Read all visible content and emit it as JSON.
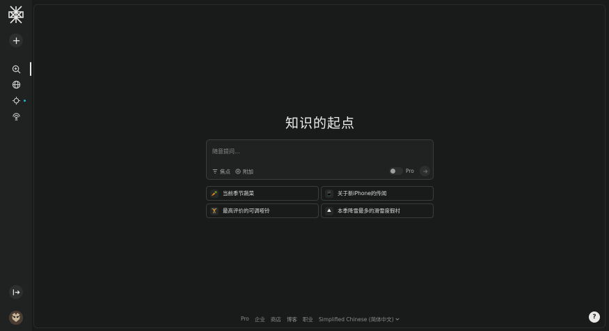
{
  "main": {
    "title": "知识的起点",
    "search": {
      "placeholder": "随意提问...",
      "focus_label": "焦点",
      "attach_label": "附加",
      "pro_label": "Pro"
    },
    "suggestions": [
      {
        "icon": "carrot-icon",
        "emoji": "🥕",
        "label": "当前季节蔬菜"
      },
      {
        "icon": "phone-icon",
        "emoji": "📱",
        "label": "关于新iPhone的传闻"
      },
      {
        "icon": "dumbbell-icon",
        "emoji": "🏋",
        "label": "最高评价的可调哑铃"
      },
      {
        "icon": "mountain-icon",
        "emoji": "⛰",
        "label": "本季降雪最多的滑雪度假村"
      }
    ],
    "footer": {
      "links": [
        "Pro",
        "企业",
        "商店",
        "博客",
        "职业"
      ],
      "language": "Simplified Chinese (简体中文)"
    },
    "help_label": "?"
  },
  "colors": {
    "background": "#191a1a",
    "sidebar": "#202222",
    "accent": "#20b8cd"
  }
}
